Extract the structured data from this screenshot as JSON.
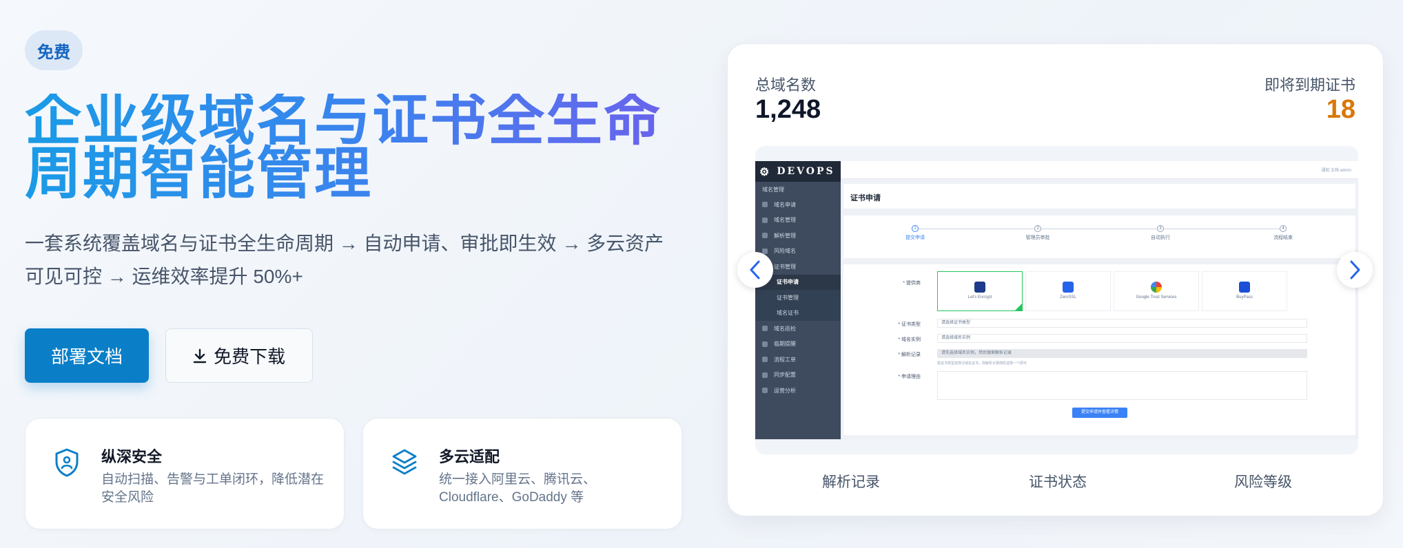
{
  "hero": {
    "badge": "免费",
    "title": "企业级域名与证书全生命周期智能管理",
    "subtitle_line1": "一套系统覆盖域名与证书全生命周期 → 自动申请、审批即生效 → 多云资产",
    "subtitle_line2": "可见可控 → 运维效率提升 50%+",
    "primary_button": "部署文档",
    "download_button": "免费下载"
  },
  "features": [
    {
      "icon": "shield-icon",
      "title": "纵深安全",
      "desc": "自动扫描、告警与工单闭环，降低潜在安全风险"
    },
    {
      "icon": "layers-icon",
      "title": "多云适配",
      "desc": "统一接入阿里云、腾讯云、Cloudflare、GoDaddy 等"
    }
  ],
  "stats": {
    "total_label": "总域名数",
    "total_value": "1,248",
    "expiring_label": "即将到期证书",
    "expiring_value": "18"
  },
  "carousel_labels": [
    "解析记录",
    "证书状态",
    "风险等级"
  ],
  "colors": {
    "accent": "#0a7fc8",
    "warning": "#d97706",
    "title_gradient_start": "#1a9be6",
    "title_gradient_end": "#6a63ec"
  },
  "preview": {
    "logo": "DEVOPS",
    "topbar": "通知  文档  admin",
    "group": "域名管理",
    "menu": [
      "域名申请",
      "域名管理",
      "解析管理",
      "风险域名",
      "证书管理",
      "证书申请",
      "证书管理",
      "域名证书",
      "域名巡检",
      "临期提醒",
      "流程工单",
      "同步配置",
      "运营分析"
    ],
    "page_title": "证书申请",
    "steps": [
      "提交申请",
      "管理员审批",
      "自动执行",
      "流程结束"
    ],
    "providers": [
      "Let's Encrypt",
      "ZeroSSL",
      "Google Trust Services",
      "BuyPass"
    ],
    "form_labels": [
      "* 提供商",
      "* 证书类型",
      "* 域名实例",
      "* 解析记录",
      "* 申请理由"
    ],
    "form_values": [
      "请选择证书类型",
      "请选择域名实例",
      "请先选择域名实例，然后搜索解析记录"
    ],
    "hint": "需证书类型选择泛域名证书，则解析记录随机选择一个即可",
    "submit": "提交申请并查看详情"
  }
}
